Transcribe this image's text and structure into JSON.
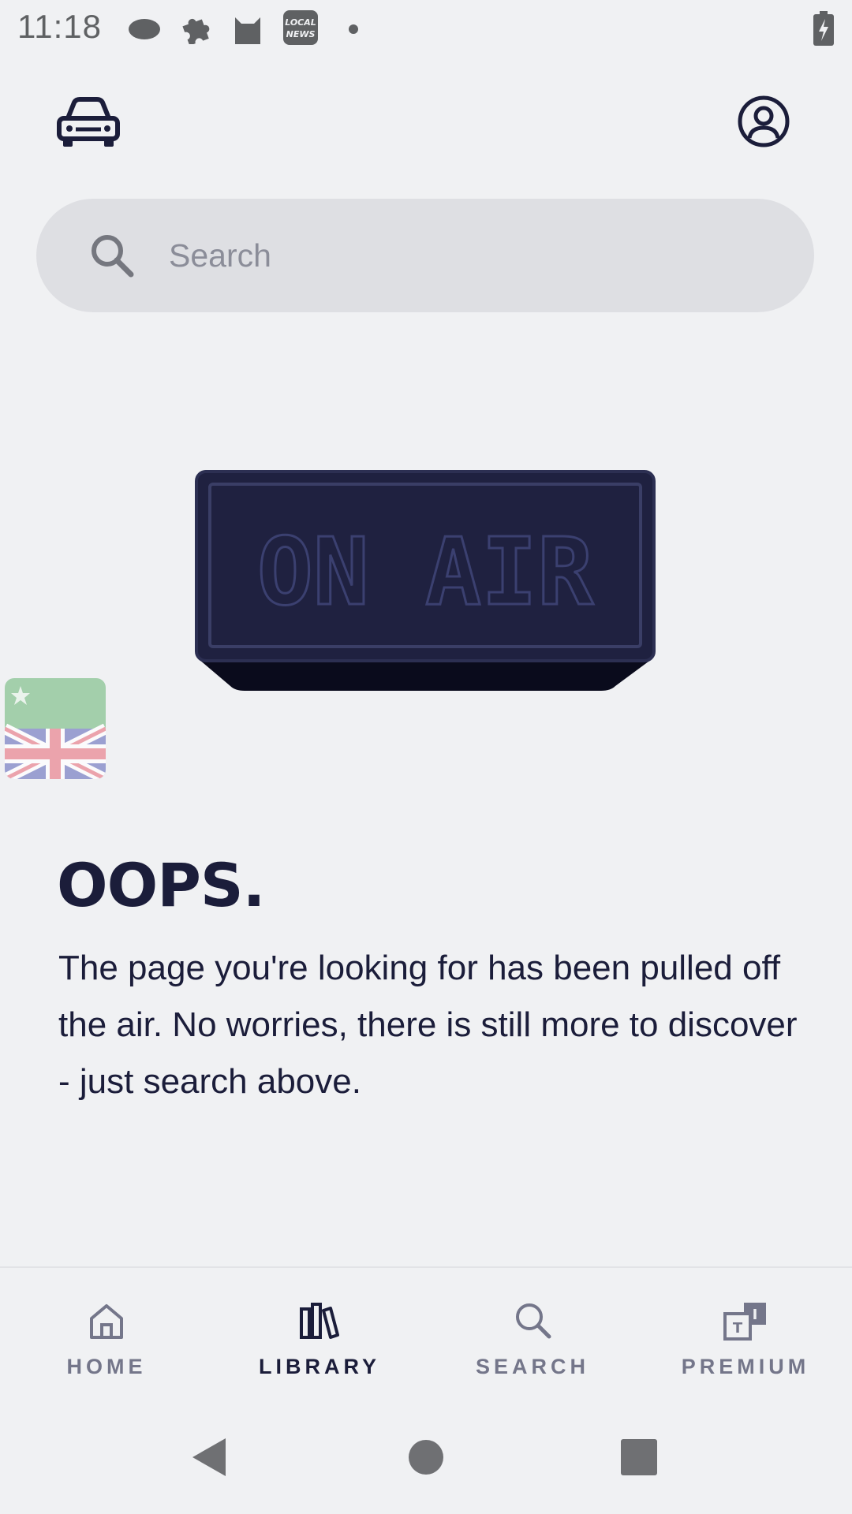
{
  "status_bar": {
    "time": "11:18",
    "notification_icons": [
      "cloud-icon",
      "puzzle-icon",
      "cat-icon",
      "local-news-icon",
      "dot-icon"
    ],
    "local_news_badge_line1": "LOCAL",
    "local_news_badge_line2": "NEWS",
    "battery": "battery-charging-icon"
  },
  "header": {
    "car_mode_icon": "car-icon",
    "account_icon": "account-icon"
  },
  "search": {
    "placeholder": "Search"
  },
  "illustration": {
    "sign_text": "ON AIR"
  },
  "error": {
    "title": "OOPS.",
    "message": "The page you're looking for has been pulled off the air. No worries, there is still more to discover - just search above."
  },
  "bottom_nav": {
    "items": [
      {
        "label": "HOME",
        "icon": "home-icon",
        "active": false
      },
      {
        "label": "LIBRARY",
        "icon": "library-icon",
        "active": true
      },
      {
        "label": "SEARCH",
        "icon": "search-icon",
        "active": false
      },
      {
        "label": "PREMIUM",
        "icon": "premium-icon",
        "active": false
      }
    ]
  },
  "colors": {
    "background": "#f0f1f3",
    "text_primary": "#1b1d3a",
    "text_muted": "#74768a",
    "search_bg": "#dedfe3",
    "sign_color": "#1f2140"
  }
}
